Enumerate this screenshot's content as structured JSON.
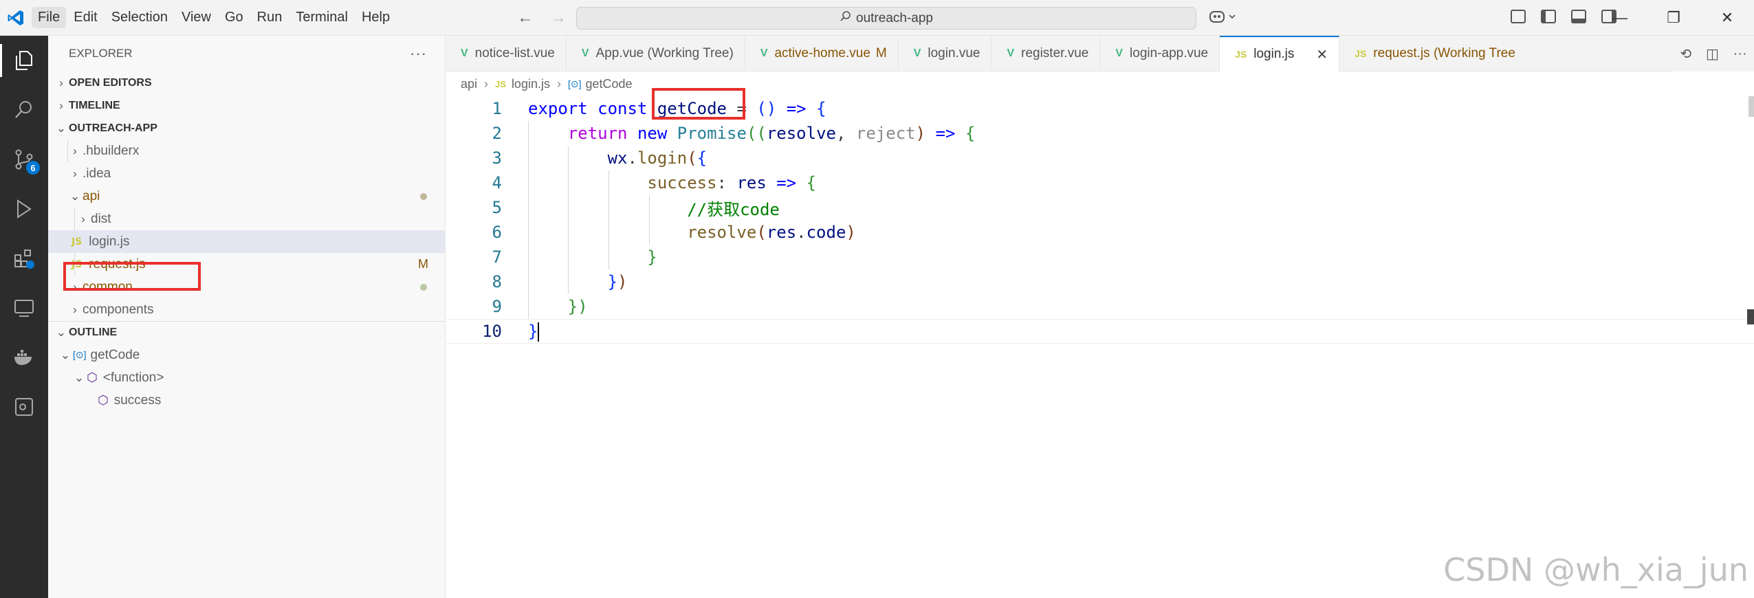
{
  "titlebar": {
    "menu": [
      "File",
      "Edit",
      "Selection",
      "View",
      "Go",
      "Run",
      "Terminal",
      "Help"
    ],
    "search": "outreach-app"
  },
  "activity": {
    "badge": "6"
  },
  "sidebar": {
    "title": "EXPLORER",
    "sections": {
      "open_editors": "OPEN EDITORS",
      "timeline": "TIMELINE",
      "project": "OUTREACH-APP",
      "outline": "OUTLINE"
    },
    "tree": [
      {
        "name": ".hbuilderx"
      },
      {
        "name": ".idea"
      },
      {
        "name": "api"
      },
      {
        "name": "dist"
      },
      {
        "name": "login.js"
      },
      {
        "name": "request.js",
        "flag": "M"
      },
      {
        "name": "common"
      },
      {
        "name": "components"
      }
    ],
    "outline": [
      {
        "name": "getCode"
      },
      {
        "name": "<function>"
      },
      {
        "name": "success"
      }
    ]
  },
  "tabs": [
    {
      "label": "notice-list.vue"
    },
    {
      "label": "App.vue (Working Tree)"
    },
    {
      "label": "active-home.vue",
      "flag": "M"
    },
    {
      "label": "login.vue"
    },
    {
      "label": "register.vue"
    },
    {
      "label": "login-app.vue"
    },
    {
      "label": "login.js"
    },
    {
      "label": "request.js (Working Tree"
    }
  ],
  "breadcrumb": [
    "api",
    "login.js",
    "getCode"
  ],
  "code": {
    "line_numbers": [
      "1",
      "2",
      "3",
      "4",
      "5",
      "6",
      "7",
      "8",
      "9",
      "10"
    ],
    "l1": {
      "a": "export",
      "b": "const",
      "c": "getCode",
      "d": "=",
      "e": "()",
      "f": "=>",
      "g": "{"
    },
    "l2": {
      "a": "return",
      "b": "new",
      "c": "Promise",
      "d": "((",
      "e": "resolve",
      "f": ",",
      "g": "reject",
      "h": ")",
      "i": "=>",
      "j": "{"
    },
    "l3": {
      "a": "wx",
      "b": ".",
      "c": "login",
      "d": "(",
      "e": "{"
    },
    "l4": {
      "a": "success",
      "b": ":",
      "c": "res",
      "d": "=>",
      "e": "{"
    },
    "l5": {
      "a": "//获取code"
    },
    "l6": {
      "a": "resolve",
      "b": "(",
      "c": "res",
      "d": ".",
      "e": "code",
      "f": ")"
    },
    "l7": {
      "a": "}"
    },
    "l8": {
      "a": "}",
      "b": ")"
    },
    "l9": {
      "a": "}",
      "b": ")"
    },
    "l10": {
      "a": "}"
    }
  },
  "watermark": "CSDN @wh_xia_jun"
}
